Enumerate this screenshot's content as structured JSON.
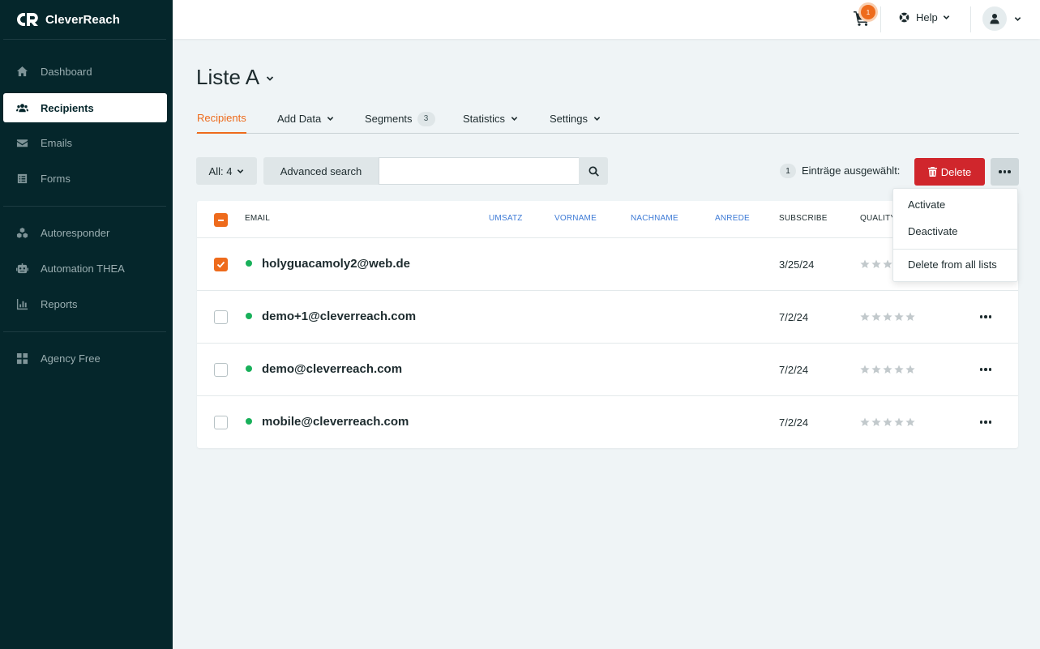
{
  "app": {
    "logo_text": "CleverReach"
  },
  "sidebar": {
    "items": [
      {
        "label": "Dashboard",
        "icon": "home-icon"
      },
      {
        "label": "Recipients",
        "icon": "users-icon"
      },
      {
        "label": "Emails",
        "icon": "envelope-icon"
      },
      {
        "label": "Forms",
        "icon": "form-icon"
      },
      {
        "label": "Autoresponder",
        "icon": "cubes-icon"
      },
      {
        "label": "Automation THEA",
        "icon": "robot-icon"
      },
      {
        "label": "Reports",
        "icon": "chart-icon"
      },
      {
        "label": "Agency Free",
        "icon": "grid-icon"
      }
    ],
    "active": "Recipients"
  },
  "topbar": {
    "cart_count": "1",
    "help_label": "Help"
  },
  "page": {
    "title": "Liste A",
    "tabs": [
      {
        "label": "Recipients"
      },
      {
        "label": "Add Data"
      },
      {
        "label": "Segments",
        "badge": "3"
      },
      {
        "label": "Statistics"
      },
      {
        "label": "Settings"
      }
    ]
  },
  "toolbar": {
    "filter_label": "All: 4",
    "advanced_search_label": "Advanced search",
    "search_value": "",
    "search_placeholder": "",
    "selected_count": "1",
    "selected_text": "Einträge ausgewählt:",
    "delete_label": "Delete"
  },
  "dropdown": {
    "items": [
      "Activate",
      "Deactivate",
      "Delete from all lists"
    ]
  },
  "table": {
    "columns": [
      "EMAIL",
      "UMSATZ",
      "VORNAME",
      "NACHNAME",
      "ANREDE",
      "SUBSCRIBE",
      "QUALITY"
    ],
    "rows": [
      {
        "email": "holyguacamoly2@web.de",
        "subscribe": "3/25/24",
        "quality": 0,
        "checked": true
      },
      {
        "email": "demo+1@cleverreach.com",
        "subscribe": "7/2/24",
        "quality": 0,
        "checked": false
      },
      {
        "email": "demo@cleverreach.com",
        "subscribe": "7/2/24",
        "quality": 0,
        "checked": false
      },
      {
        "email": "mobile@cleverreach.com",
        "subscribe": "7/2/24",
        "quality": 0,
        "checked": false
      }
    ]
  },
  "colors": {
    "sidebar_bg": "#05262b",
    "accent": "#ee6b1c",
    "danger": "#d0262c",
    "status_active": "#18b05a",
    "link": "#3e7bd6"
  }
}
